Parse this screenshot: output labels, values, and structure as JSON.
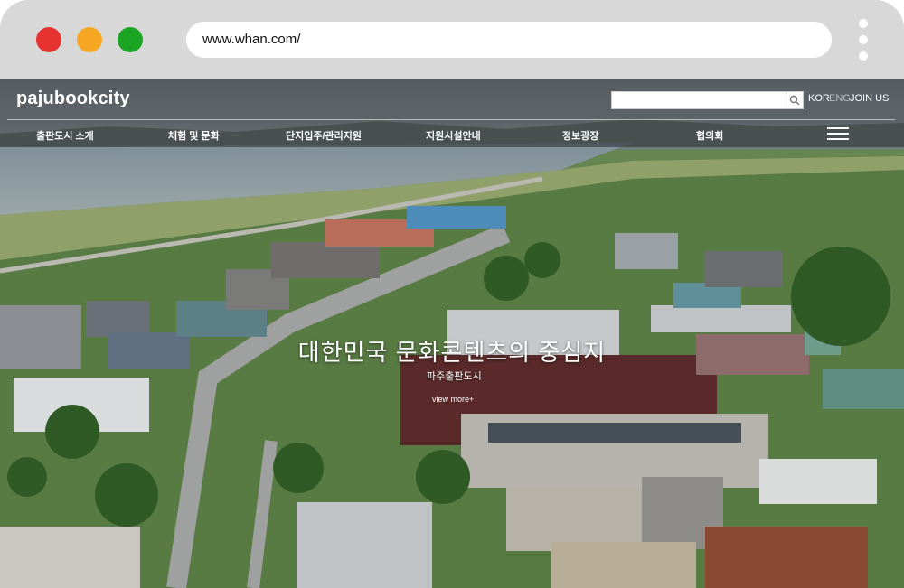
{
  "browser": {
    "url": "www.whan.com/",
    "window_buttons": [
      "close",
      "minimize",
      "maximize"
    ],
    "menu_icon": "kebab-icon"
  },
  "site": {
    "logo": "pajubookcity",
    "search": {
      "placeholder": "",
      "button_icon": "search-icon"
    },
    "languages": [
      "KOR",
      "ENG"
    ],
    "join": "JOIN US",
    "nav": [
      "출판도시 소개",
      "체험 및 문화",
      "단지입주/관리지원",
      "지원시설안내",
      "정보광장",
      "협의회"
    ],
    "menu_icon": "hamburger-icon"
  },
  "hero": {
    "headline": "대한민국 문화콘텐츠의 중심지",
    "subline": "파주출판도시",
    "cta": "view more+"
  },
  "colors": {
    "chrome": "#d8d8d8",
    "close": "#e63131",
    "minimize": "#f5a623",
    "maximize": "#1aa524",
    "nav_overlay": "rgba(40,44,48,0.55)"
  }
}
